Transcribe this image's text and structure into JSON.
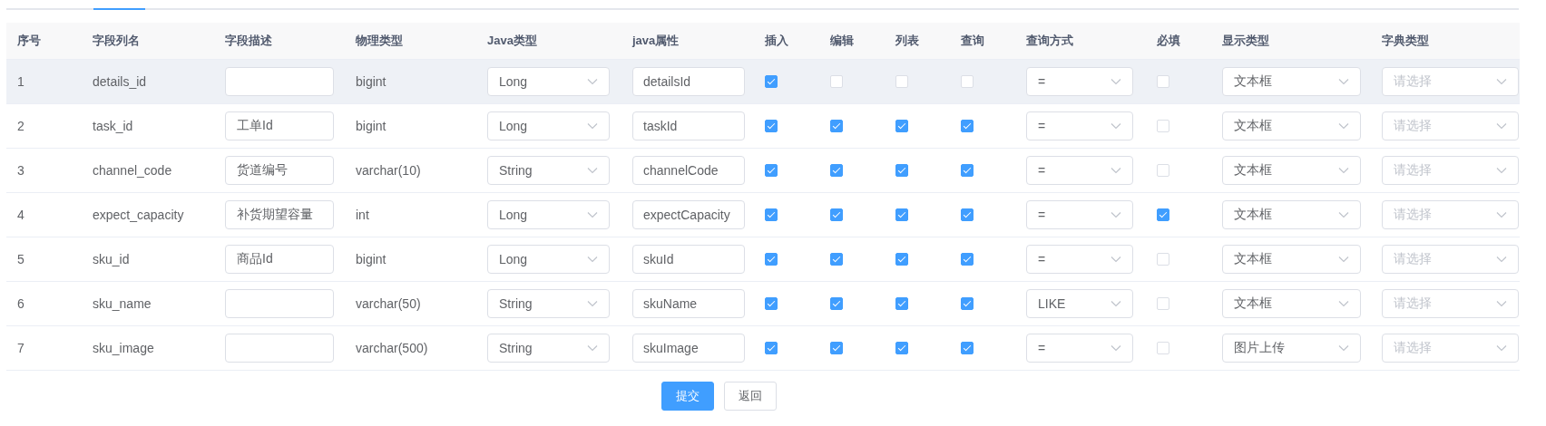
{
  "table": {
    "columns": [
      "序号",
      "字段列名",
      "字段描述",
      "物理类型",
      "Java类型",
      "java属性",
      "插入",
      "编辑",
      "列表",
      "查询",
      "查询方式",
      "必填",
      "显示类型",
      "字典类型"
    ],
    "rows": [
      {
        "highlighted": true,
        "index": "1",
        "column_name": "details_id",
        "description": {},
        "physical_type": "bigint",
        "java_type": "Long",
        "java_field": "detailsId",
        "insert": true,
        "edit": false,
        "list": false,
        "query": false,
        "query_mode": "=",
        "required": false,
        "display_type": "文本框",
        "dict_type": {
          "placeholder": "请选择"
        }
      },
      {
        "highlighted": false,
        "index": "2",
        "column_name": "task_id",
        "description": {
          "value": "工单Id"
        },
        "physical_type": "bigint",
        "java_type": "Long",
        "java_field": "taskId",
        "insert": true,
        "edit": true,
        "list": true,
        "query": true,
        "query_mode": "=",
        "required": false,
        "display_type": "文本框",
        "dict_type": {
          "placeholder": "请选择"
        }
      },
      {
        "highlighted": false,
        "index": "3",
        "column_name": "channel_code",
        "description": {
          "value": "货道编号"
        },
        "physical_type": "varchar(10)",
        "java_type": "String",
        "java_field": "channelCode",
        "insert": true,
        "edit": true,
        "list": true,
        "query": true,
        "query_mode": "=",
        "required": false,
        "display_type": "文本框",
        "dict_type": {
          "placeholder": "请选择"
        }
      },
      {
        "highlighted": false,
        "index": "4",
        "column_name": "expect_capacity",
        "description": {
          "value": "补货期望容量"
        },
        "physical_type": "int",
        "java_type": "Long",
        "java_field": "expectCapacity",
        "insert": true,
        "edit": true,
        "list": true,
        "query": true,
        "query_mode": "=",
        "required": true,
        "display_type": "文本框",
        "dict_type": {
          "placeholder": "请选择"
        }
      },
      {
        "highlighted": false,
        "index": "5",
        "column_name": "sku_id",
        "description": {
          "value": "商品Id"
        },
        "physical_type": "bigint",
        "java_type": "Long",
        "java_field": "skuId",
        "insert": true,
        "edit": true,
        "list": true,
        "query": true,
        "query_mode": "=",
        "required": false,
        "display_type": "文本框",
        "dict_type": {
          "placeholder": "请选择"
        }
      },
      {
        "highlighted": false,
        "index": "6",
        "column_name": "sku_name",
        "description": {},
        "physical_type": "varchar(50)",
        "java_type": "String",
        "java_field": "skuName",
        "insert": true,
        "edit": true,
        "list": true,
        "query": true,
        "query_mode": "LIKE",
        "required": false,
        "display_type": "文本框",
        "dict_type": {
          "placeholder": "请选择"
        }
      },
      {
        "highlighted": false,
        "index": "7",
        "column_name": "sku_image",
        "description": {},
        "physical_type": "varchar(500)",
        "java_type": "String",
        "java_field": "skuImage",
        "insert": true,
        "edit": true,
        "list": true,
        "query": true,
        "query_mode": "=",
        "required": false,
        "display_type": "图片上传",
        "dict_type": {
          "placeholder": "请选择"
        }
      }
    ]
  },
  "buttons": [
    {
      "label": "提交",
      "kind": "primary"
    },
    {
      "label": "返回",
      "kind": "default"
    }
  ]
}
